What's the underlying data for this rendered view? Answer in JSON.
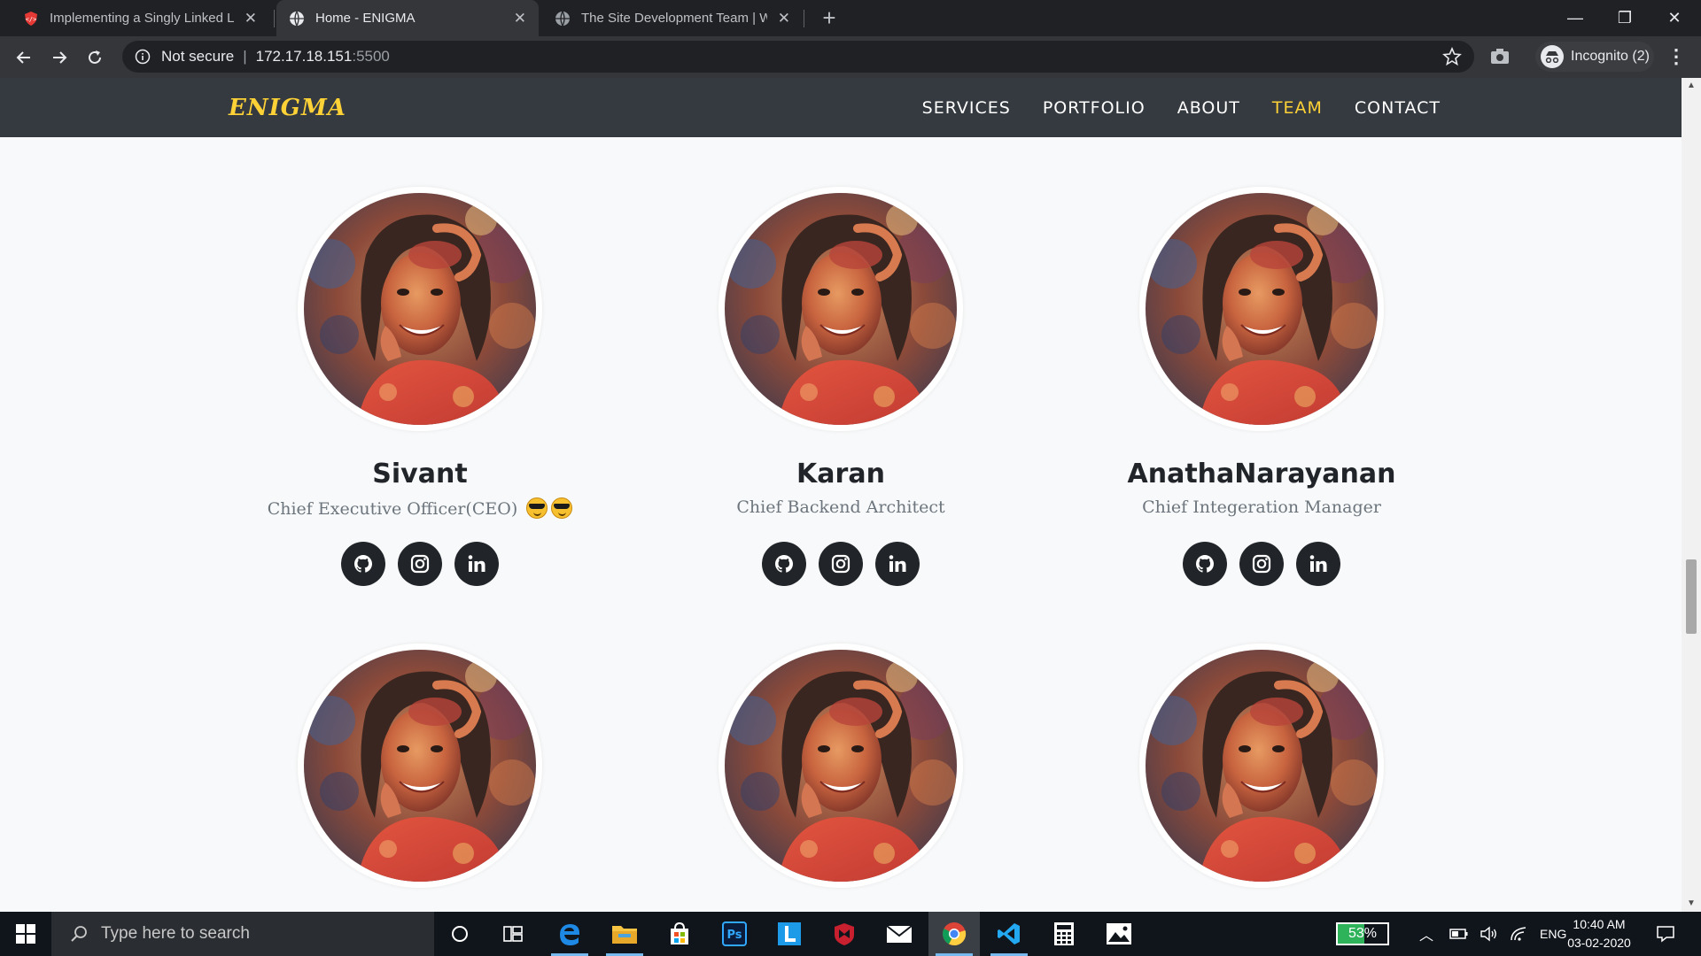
{
  "browser": {
    "tabs": [
      {
        "title": "Implementing a Singly Linked Lis",
        "active": false
      },
      {
        "title": "Home - ENIGMA",
        "active": true
      },
      {
        "title": "The Site Development Team | We",
        "active": false
      }
    ],
    "address": {
      "secure_label": "Not secure",
      "host": "172.17.18.151",
      "port": ":5500"
    },
    "profile_label": "Incognito (2)"
  },
  "site": {
    "brand": "ENIGMA",
    "nav": [
      {
        "label": "SERVICES",
        "active": false
      },
      {
        "label": "PORTFOLIO",
        "active": false
      },
      {
        "label": "ABOUT",
        "active": false
      },
      {
        "label": "TEAM",
        "active": true
      },
      {
        "label": "CONTACT",
        "active": false
      }
    ],
    "colors": {
      "nav_bg": "#343a40",
      "accent": "#fed136",
      "social_bg": "#212529",
      "page_bg": "#f8f9fa"
    }
  },
  "team": [
    {
      "name": "Sivant",
      "role": "Chief Executive Officer(CEO)",
      "emoji": [
        "smiling-face-with-sunglasses-emoji",
        "smiling-face-with-sunglasses-emoji"
      ]
    },
    {
      "name": "Karan",
      "role": "Chief Backend Architect"
    },
    {
      "name": "AnathaNarayanan",
      "role": "Chief Integeration Manager"
    },
    {
      "name": "",
      "role": ""
    },
    {
      "name": "",
      "role": ""
    },
    {
      "name": "",
      "role": ""
    }
  ],
  "social_icons": [
    "github-icon",
    "instagram-icon",
    "linkedin-icon"
  ],
  "taskbar": {
    "search_placeholder": "Type here to search",
    "battery": "53%",
    "language": "ENG",
    "time": "10:40 AM",
    "date": "03-02-2020",
    "apps": [
      "cortana-icon",
      "task-view-icon",
      "edge-icon",
      "file-explorer-icon",
      "store-icon",
      "photoshop-icon",
      "l-app-icon",
      "mcafee-icon",
      "mail-icon",
      "chrome-icon",
      "vscode-icon",
      "calculator-icon",
      "photos-icon"
    ]
  }
}
